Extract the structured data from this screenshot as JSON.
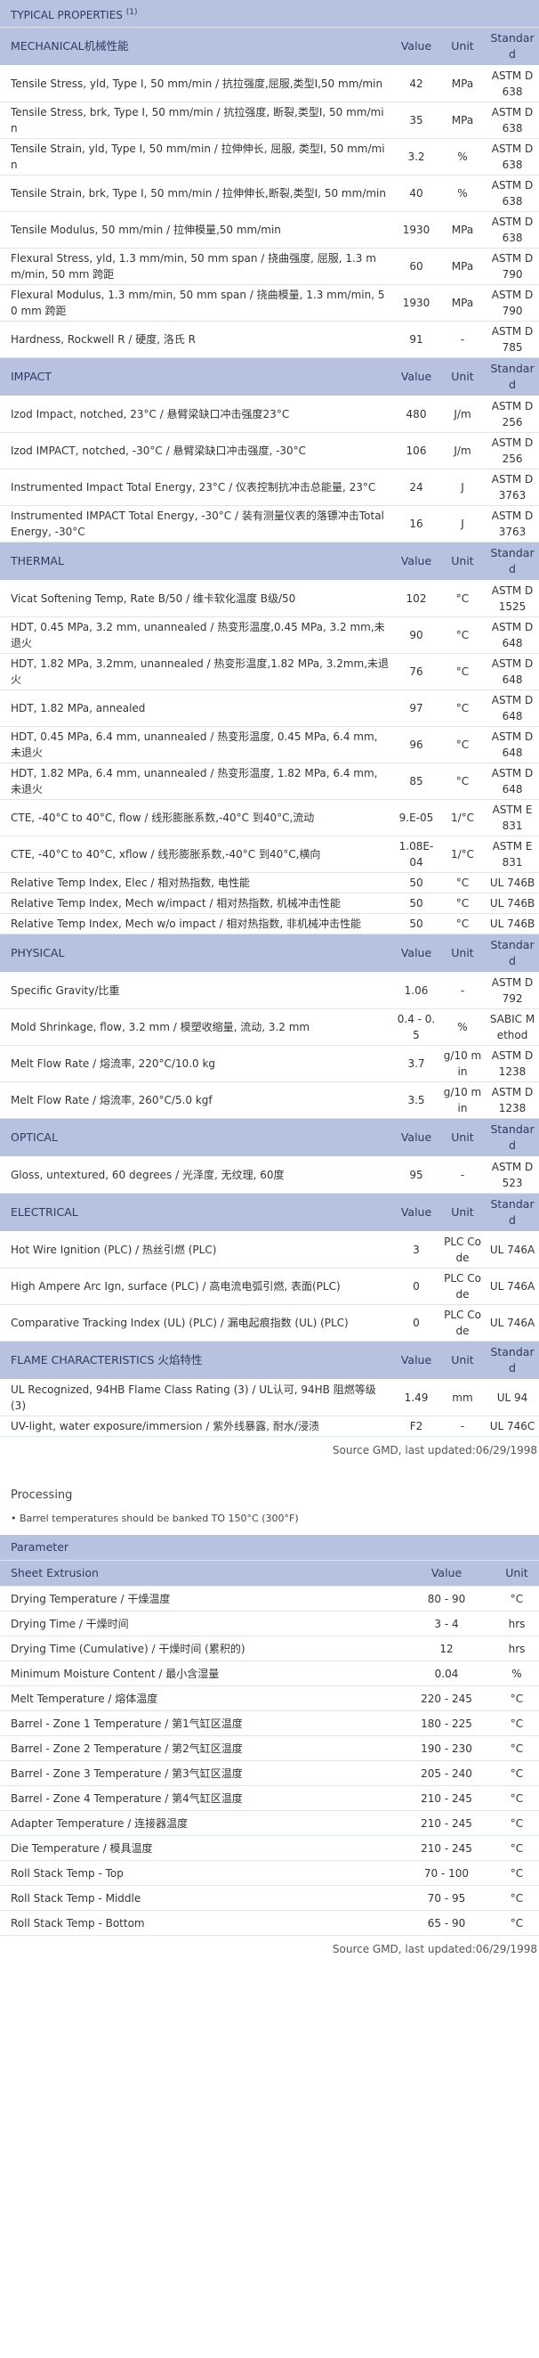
{
  "typical_properties": {
    "title": "TYPICAL PROPERTIES",
    "title_sup": "(1)",
    "sections": [
      {
        "name": "MECHANICAL机械性能",
        "headers": [
          "Value",
          "Unit",
          "Standard"
        ],
        "rows": [
          [
            "Tensile Stress, yld, Type I, 50 mm/min / 抗拉强度,屈服,类型I,50 mm/min",
            "42",
            "MPa",
            "ASTM D 638"
          ],
          [
            "Tensile Stress, brk, Type I, 50 mm/min / 抗拉强度, 断裂,类型I, 50 mm/min",
            "35",
            "MPa",
            "ASTM D 638"
          ],
          [
            "Tensile Strain, yld, Type I, 50 mm/min / 拉伸伸长, 屈服, 类型I, 50 mm/min",
            "3.2",
            "%",
            "ASTM D 638"
          ],
          [
            "Tensile Strain, brk, Type I, 50 mm/min / 拉伸伸长,断裂,类型I, 50 mm/min",
            "40",
            "%",
            "ASTM D 638"
          ],
          [
            "Tensile Modulus, 50 mm/min / 拉伸模量,50 mm/min",
            "1930",
            "MPa",
            "ASTM D 638"
          ],
          [
            "Flexural Stress, yld, 1.3 mm/min, 50 mm span / 挠曲强度, 屈服, 1.3 mm/min, 50 mm 跨距",
            "60",
            "MPa",
            "ASTM D 790"
          ],
          [
            "Flexural Modulus, 1.3 mm/min, 50 mm span / 挠曲模量, 1.3 mm/min, 50 mm 跨距",
            "1930",
            "MPa",
            "ASTM D 790"
          ],
          [
            "Hardness, Rockwell R / 硬度, 洛氏 R",
            "91",
            "-",
            "ASTM D 785"
          ]
        ]
      },
      {
        "name": "IMPACT",
        "headers": [
          "Value",
          "Unit",
          "Standard"
        ],
        "rows": [
          [
            "Izod Impact, notched, 23°C / 悬臂梁缺口冲击强度23°C",
            "480",
            "J/m",
            "ASTM D 256"
          ],
          [
            "Izod IMPACT, notched, -30°C / 悬臂梁缺口冲击强度, -30°C",
            "106",
            "J/m",
            "ASTM D 256"
          ],
          [
            "Instrumented Impact Total Energy, 23°C / 仪表控制抗冲击总能量, 23°C",
            "24",
            "J",
            "ASTM D 3763"
          ],
          [
            "Instrumented IMPACT Total Energy, -30°C / 装有测量仪表的落镖冲击Total Energy, -30°C",
            "16",
            "J",
            "ASTM D 3763"
          ]
        ]
      },
      {
        "name": "THERMAL",
        "headers": [
          "Value",
          "Unit",
          "Standard"
        ],
        "rows": [
          [
            "Vicat Softening Temp, Rate B/50 / 维卡软化温度 B级/50",
            "102",
            "°C",
            "ASTM D 1525"
          ],
          [
            "HDT, 0.45 MPa, 3.2 mm, unannealed / 热变形温度,0.45 MPa, 3.2 mm,未退火",
            "90",
            "°C",
            "ASTM D 648"
          ],
          [
            "HDT, 1.82 MPa, 3.2mm, unannealed / 热变形温度,1.82 MPa, 3.2mm,未退火",
            "76",
            "°C",
            "ASTM D 648"
          ],
          [
            "HDT, 1.82 MPa, annealed",
            "97",
            "°C",
            "ASTM D 648"
          ],
          [
            "HDT, 0.45 MPa, 6.4 mm, unannealed / 热变形温度, 0.45 MPa, 6.4 mm, 未退火",
            "96",
            "°C",
            "ASTM D 648"
          ],
          [
            "HDT, 1.82 MPa, 6.4 mm, unannealed / 热变形温度, 1.82 MPa, 6.4 mm, 未退火",
            "85",
            "°C",
            "ASTM D 648"
          ],
          [
            "CTE, -40°C to 40°C, flow / 线形膨胀系数,-40°C 到40°C,流动",
            "9.E-05",
            "1/°C",
            "ASTM E 831"
          ],
          [
            "CTE, -40°C to 40°C, xflow / 线形膨胀系数,-40°C 到40°C,横向",
            "1.08E-04",
            "1/°C",
            "ASTM E 831"
          ],
          [
            "Relative Temp Index, Elec / 相对热指数, 电性能",
            "50",
            "°C",
            "UL 746B"
          ],
          [
            "Relative Temp Index, Mech w/impact / 相对热指数, 机械冲击性能",
            "50",
            "°C",
            "UL 746B"
          ],
          [
            "Relative Temp Index, Mech w/o impact / 相对热指数, 非机械冲击性能",
            "50",
            "°C",
            "UL 746B"
          ]
        ]
      },
      {
        "name": "PHYSICAL",
        "headers": [
          "Value",
          "Unit",
          "Standard"
        ],
        "rows": [
          [
            "Specific Gravity/比重",
            "1.06",
            "-",
            "ASTM D 792"
          ],
          [
            "Mold Shrinkage, flow, 3.2 mm / 模塑收缩量, 流动, 3.2 mm",
            "0.4 - 0.5",
            "%",
            "SABIC Method"
          ],
          [
            "Melt Flow Rate / 熔流率, 220°C/10.0 kg",
            "3.7",
            "g/10 min",
            "ASTM D 1238"
          ],
          [
            "Melt Flow Rate / 熔流率, 260°C/5.0 kgf",
            "3.5",
            "g/10 min",
            "ASTM D 1238"
          ]
        ]
      },
      {
        "name": "OPTICAL",
        "headers": [
          "Value",
          "Unit",
          "Standard"
        ],
        "rows": [
          [
            "Gloss, untextured, 60 degrees / 光泽度, 无纹理, 60度",
            "95",
            "-",
            "ASTM D 523"
          ]
        ]
      },
      {
        "name": "ELECTRICAL",
        "headers": [
          "Value",
          "Unit",
          "Standard"
        ],
        "rows": [
          [
            "Hot Wire Ignition (PLC) / 热丝引燃 (PLC)",
            "3",
            "PLC Code",
            "UL 746A"
          ],
          [
            "High Ampere Arc Ign, surface (PLC) / 高电流电弧引燃, 表面(PLC)",
            "0",
            "PLC Code",
            "UL 746A"
          ],
          [
            "Comparative Tracking Index (UL) (PLC) / 漏电起痕指数 (UL) (PLC)",
            "0",
            "PLC Code",
            "UL 746A"
          ]
        ]
      },
      {
        "name": "FLAME CHARACTERISTICS 火焰特性",
        "headers": [
          "Value",
          "Unit",
          "Standard"
        ],
        "rows": [
          [
            "UL Recognized, 94HB Flame Class Rating (3) / UL认可, 94HB 阻燃等级(3)",
            "1.49",
            "mm",
            "UL 94"
          ],
          [
            "UV-light, water exposure/immersion / 紫外线暴露, 耐水/浸渍",
            "F2",
            "-",
            "UL 746C"
          ]
        ]
      }
    ],
    "source": "Source GMD, last updated:06/29/1998"
  },
  "processing": {
    "title": "Processing",
    "note": "• Barrel temperatures should be banked TO 150°C (300°F)",
    "param_header": "Parameter",
    "section": "Sheet Extrusion",
    "headers": [
      "Value",
      "Unit"
    ],
    "rows": [
      [
        "Drying Temperature / 干燥温度",
        "80 - 90",
        "°C"
      ],
      [
        "Drying Time / 干燥时间",
        "3 - 4",
        "hrs"
      ],
      [
        "Drying Time (Cumulative) / 干燥时间 (累积的)",
        "12",
        "hrs"
      ],
      [
        "Minimum Moisture Content / 最小含湿量",
        "0.04",
        "%"
      ],
      [
        "Melt Temperature / 熔体温度",
        "220 - 245",
        "°C"
      ],
      [
        "Barrel - Zone 1 Temperature / 第1气缸区温度",
        "180 - 225",
        "°C"
      ],
      [
        "Barrel - Zone 2 Temperature / 第2气缸区温度",
        "190 - 230",
        "°C"
      ],
      [
        "Barrel - Zone 3 Temperature / 第3气缸区温度",
        "205 - 240",
        "°C"
      ],
      [
        "Barrel - Zone 4 Temperature / 第4气缸区温度",
        "210 - 245",
        "°C"
      ],
      [
        "Adapter Temperature / 连接器温度",
        "210 - 245",
        "°C"
      ],
      [
        "Die Temperature / 模具温度",
        "210 - 245",
        "°C"
      ],
      [
        "Roll Stack Temp - Top",
        "70 - 100",
        "°C"
      ],
      [
        "Roll Stack Temp - Middle",
        "70 - 95",
        "°C"
      ],
      [
        "Roll Stack Temp - Bottom",
        "65 - 90",
        "°C"
      ]
    ],
    "source": "Source GMD, last updated:06/29/1998"
  }
}
